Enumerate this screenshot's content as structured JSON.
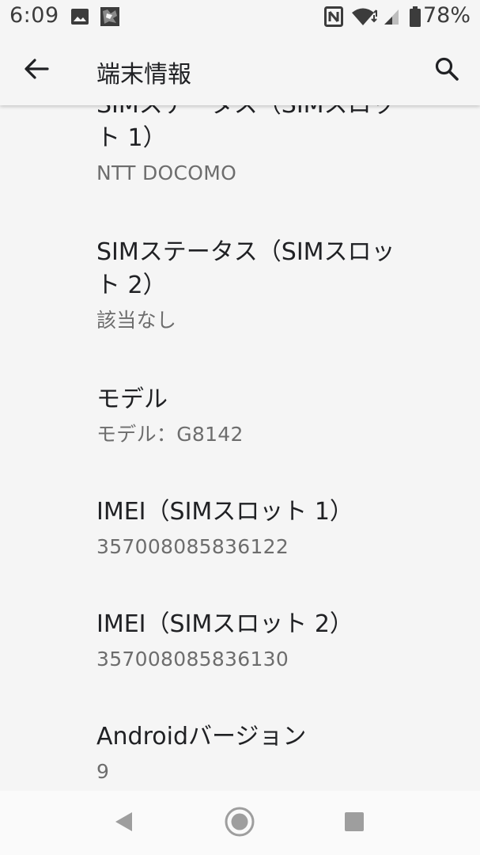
{
  "status_bar": {
    "time": "6:09",
    "battery": "78%",
    "icons": [
      "image-icon",
      "notification-app-icon",
      "nfc-icon",
      "wifi-icon",
      "cell-signal-icon",
      "battery-icon"
    ]
  },
  "app_bar": {
    "title": "端末情報",
    "back_icon": "arrow-back-icon",
    "search_icon": "search-icon"
  },
  "items": [
    {
      "title_line1": "SIMステータス（SIMスロッ",
      "title_line2": "ト 1）",
      "summary": "NTT DOCOMO"
    },
    {
      "title_line1": "SIMステータス（SIMスロッ",
      "title_line2": "ト 2）",
      "summary": "該当なし"
    },
    {
      "title": "モデル",
      "summary": "モデル：G8142"
    },
    {
      "title": "IMEI（SIMスロット 1）",
      "summary": "357008085836122"
    },
    {
      "title": "IMEI（SIMスロット 2）",
      "summary": "357008085836130"
    },
    {
      "title": "Androidバージョン",
      "summary": "9"
    }
  ],
  "nav_bar": {
    "back_icon": "nav-back-icon",
    "home_icon": "nav-home-icon",
    "recents_icon": "nav-recents-icon"
  },
  "colors": {
    "background": "#f5f5f5",
    "title_text": "#202124",
    "summary_text": "#6d6d6d",
    "icon": "#3c3c3c"
  }
}
